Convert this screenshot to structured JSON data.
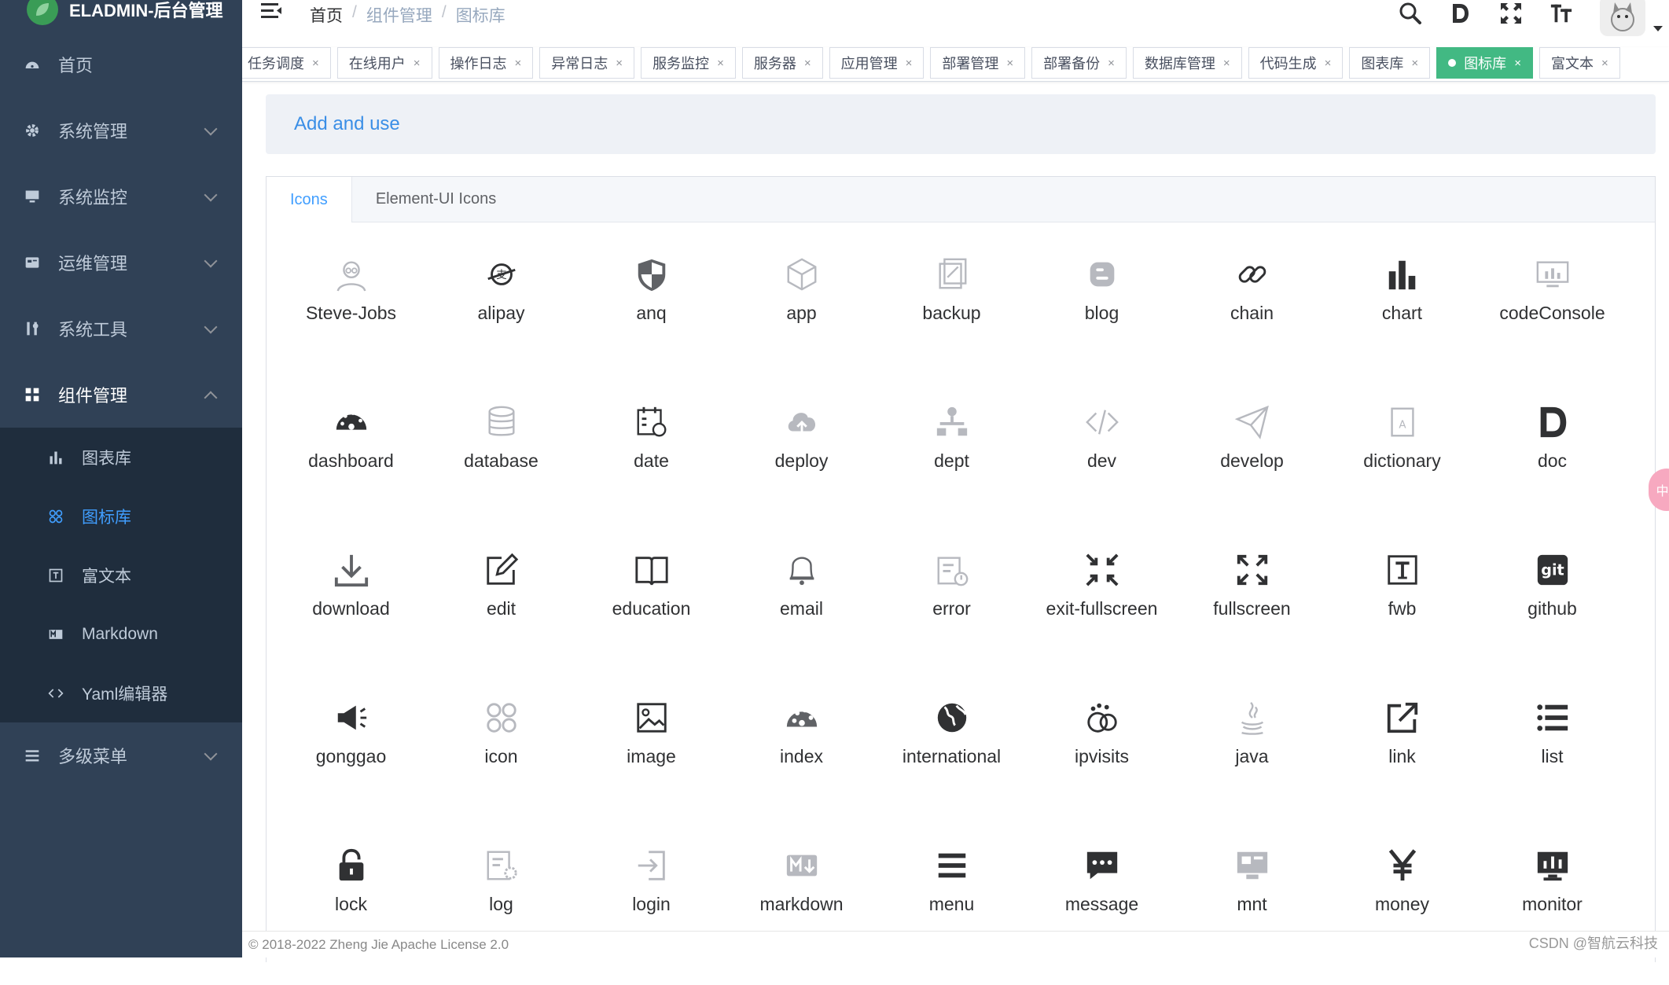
{
  "app": {
    "title": "ELADMIN-后台管理"
  },
  "sidebar": {
    "items": [
      {
        "label": "首页",
        "icon": "dashboard-icon"
      },
      {
        "label": "系统管理",
        "icon": "gear-icon"
      },
      {
        "label": "系统监控",
        "icon": "monitor-icon"
      },
      {
        "label": "运维管理",
        "icon": "ops-icon"
      },
      {
        "label": "系统工具",
        "icon": "tools-icon"
      },
      {
        "label": "组件管理",
        "icon": "grid-icon"
      },
      {
        "label": "多级菜单",
        "icon": "menu-icon"
      }
    ],
    "submenu": [
      {
        "label": "图表库",
        "icon": "chart-icon"
      },
      {
        "label": "图标库",
        "icon": "icon-icon"
      },
      {
        "label": "富文本",
        "icon": "fwb-icon"
      },
      {
        "label": "Markdown",
        "icon": "markdown-icon"
      },
      {
        "label": "Yaml编辑器",
        "icon": "code-icon"
      }
    ]
  },
  "breadcrumb": {
    "items": [
      "首页",
      "组件管理",
      "图标库"
    ],
    "separator": "/"
  },
  "tags": [
    {
      "label": "任务调度"
    },
    {
      "label": "在线用户"
    },
    {
      "label": "操作日志"
    },
    {
      "label": "异常日志"
    },
    {
      "label": "服务监控"
    },
    {
      "label": "服务器"
    },
    {
      "label": "应用管理"
    },
    {
      "label": "部署管理"
    },
    {
      "label": "部署备份"
    },
    {
      "label": "数据库管理"
    },
    {
      "label": "代码生成"
    },
    {
      "label": "图表库"
    },
    {
      "label": "图标库"
    },
    {
      "label": "富文本"
    }
  ],
  "close_glyph": "×",
  "main": {
    "add_panel": "Add and use",
    "tabs": [
      "Icons",
      "Element-UI Icons"
    ],
    "icons": [
      "Steve-Jobs",
      "alipay",
      "anq",
      "app",
      "backup",
      "blog",
      "chain",
      "chart",
      "codeConsole",
      "dashboard",
      "database",
      "date",
      "deploy",
      "dept",
      "dev",
      "develop",
      "dictionary",
      "doc",
      "download",
      "edit",
      "education",
      "email",
      "error",
      "exit-fullscreen",
      "fullscreen",
      "fwb",
      "github",
      "gonggao",
      "icon",
      "image",
      "index",
      "international",
      "ipvisits",
      "java",
      "link",
      "list",
      "lock",
      "log",
      "login",
      "markdown",
      "menu",
      "message",
      "mnt",
      "money",
      "monitor"
    ]
  },
  "footer": {
    "text": "© 2018-2022 Zheng Jie Apache License 2.0",
    "watermark": "CSDN @智航云科技"
  },
  "float_pill": {
    "text": "中A"
  },
  "colors": {
    "sidebar": "#304156",
    "submenu": "#1f2d3d",
    "accent": "#409eff",
    "tag_active": "#42b983"
  }
}
